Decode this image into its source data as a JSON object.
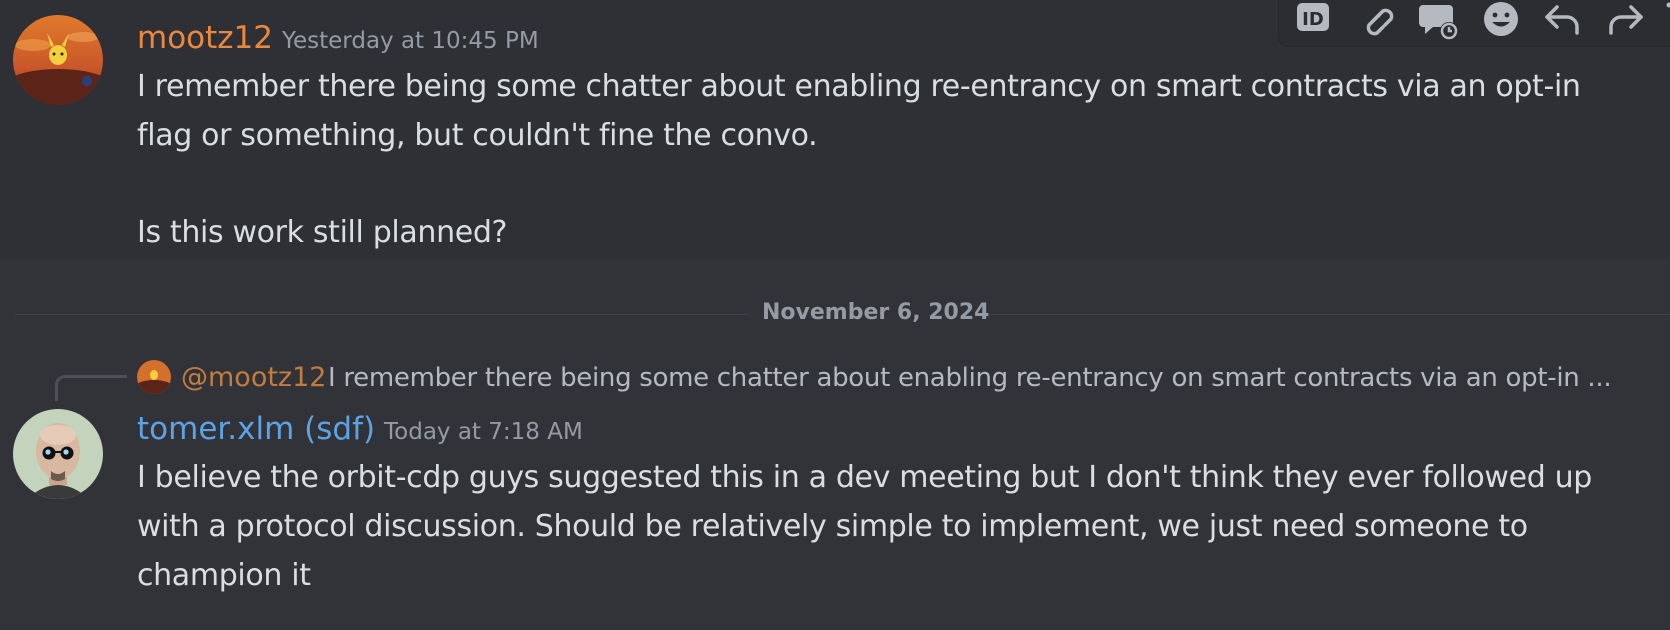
{
  "messages": [
    {
      "author": "mootz12",
      "author_color": "#e9883e",
      "timestamp": "Yesterday at 10:45 PM",
      "avatar_icon": "pikachu-avatar-icon",
      "lines": [
        "I remember there being some chatter about enabling re-entrancy on smart contracts via an opt-in",
        "flag or something, but couldn't fine the convo.",
        "",
        "Is this work still planned?"
      ]
    },
    {
      "author": "tomer.xlm (sdf)",
      "author_color": "#5ca3e6",
      "timestamp": "Today at 7:18 AM",
      "avatar_icon": "bald-man-sunglasses-avatar-icon",
      "lines": [
        "I believe the orbit-cdp guys suggested this in a dev meeting but I don't think they ever followed up",
        "with a protocol discussion. Should be relatively simple to implement, we just need someone to",
        "champion it"
      ]
    }
  ],
  "date_divider": "November 6, 2024",
  "reply": {
    "author": "@mootz12",
    "text": "I remember there being some chatter about enabling re-entrancy on smart contracts via an opt-in ..."
  },
  "toolbar": {
    "icons": [
      "copy-id-icon",
      "copy-link-icon",
      "create-thread-icon",
      "add-reaction-icon",
      "reply-icon",
      "forward-icon"
    ]
  },
  "colors": {
    "background": "#313338",
    "hover_background": "#2e3035",
    "text": "#dbdee1",
    "muted": "#949ba4",
    "mootz12": "#e9883e",
    "tomer": "#5ca3e6"
  }
}
